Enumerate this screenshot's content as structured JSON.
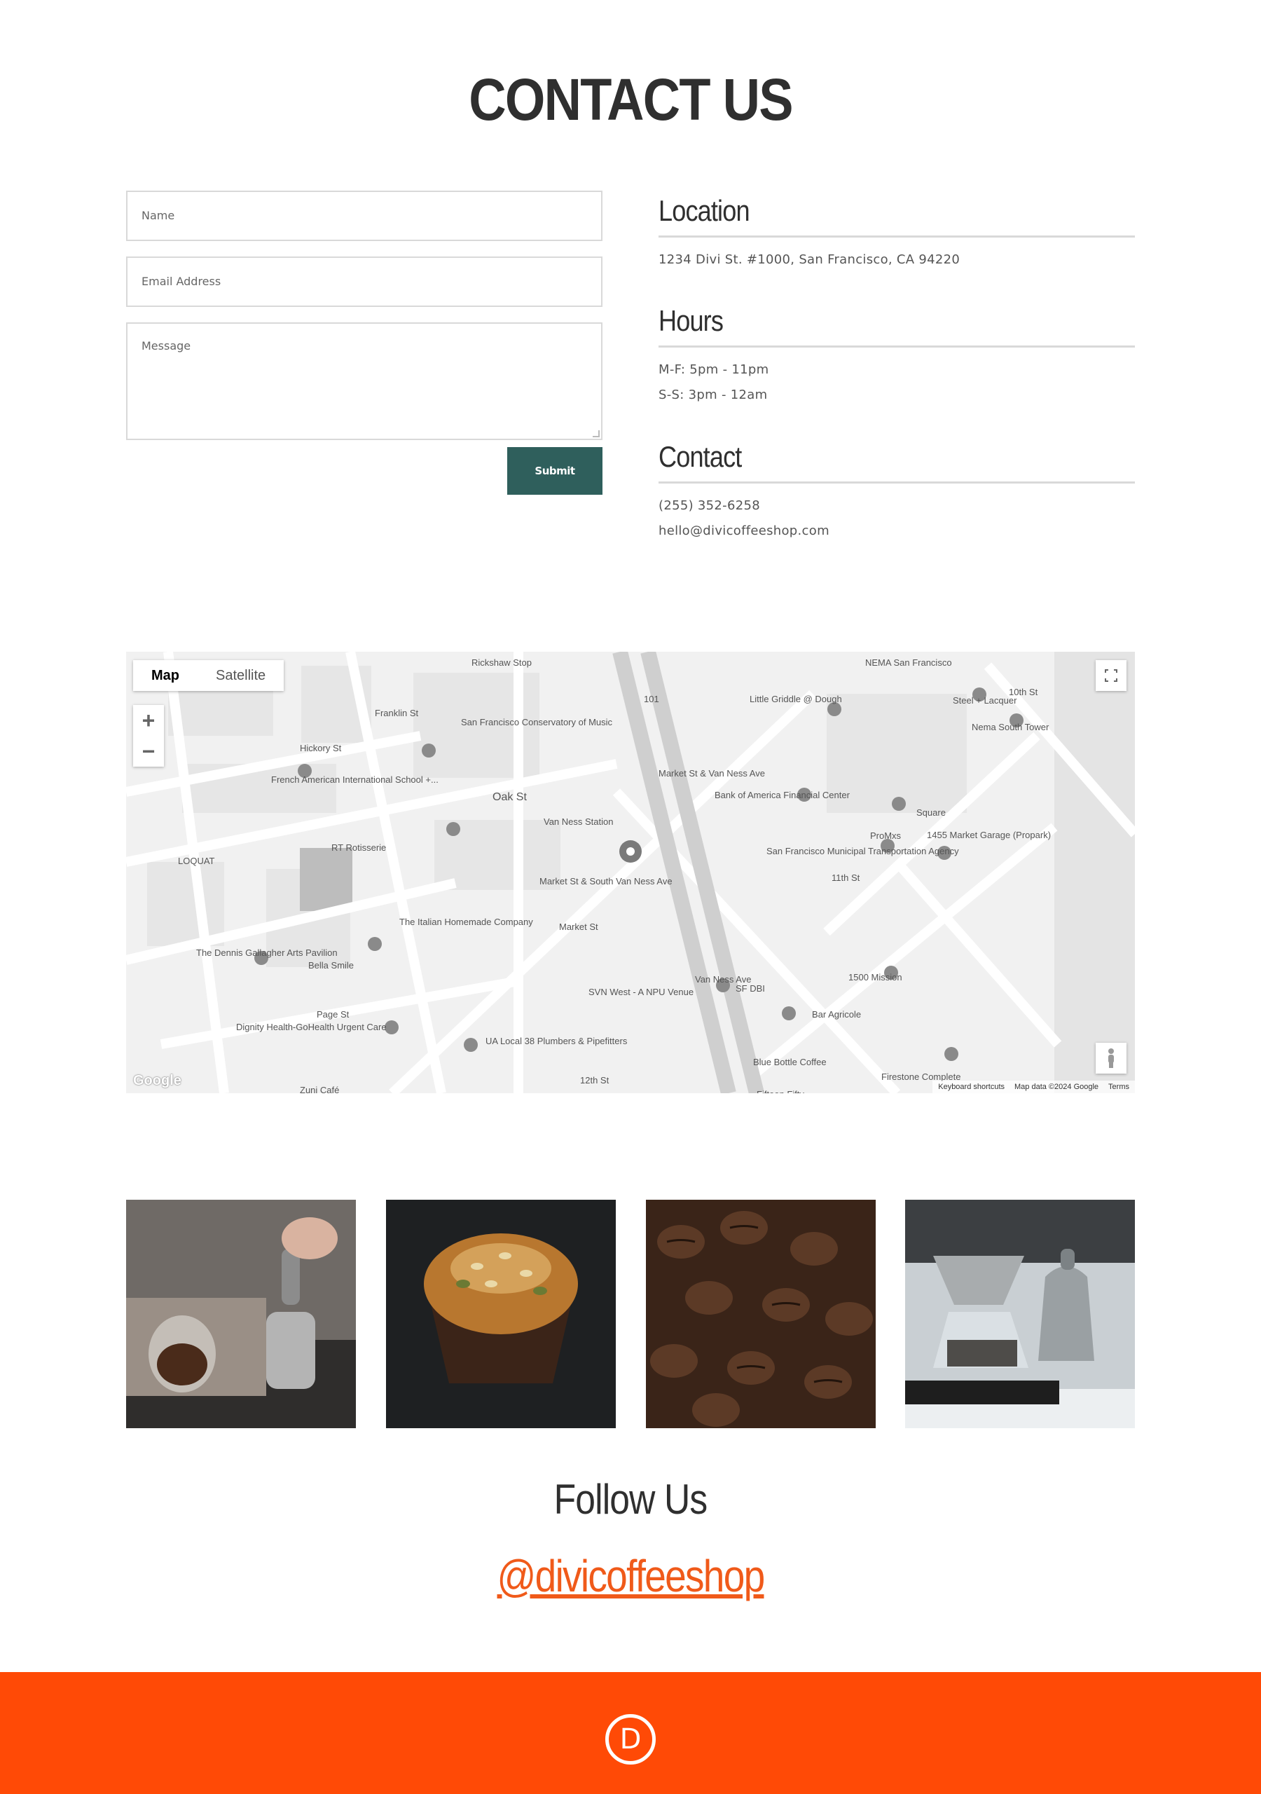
{
  "page": {
    "title": "CONTACT US"
  },
  "form": {
    "name_placeholder": "Name",
    "email_placeholder": "Email Address",
    "message_placeholder": "Message",
    "submit_label": "Submit"
  },
  "info": {
    "location": {
      "heading": "Location",
      "address": "1234 Divi St. #1000, San Francisco, CA 94220"
    },
    "hours": {
      "heading": "Hours",
      "weekday": "M-F: 5pm - 11pm",
      "weekend": "S-S: 3pm - 12am"
    },
    "contact": {
      "heading": "Contact",
      "phone": "(255) 352-6258",
      "email": "hello@divicoffeeshop.com"
    }
  },
  "map": {
    "type_map": "Map",
    "type_satellite": "Satellite",
    "zoom_in": "+",
    "zoom_out": "−",
    "google": "Google",
    "footer_shortcuts": "Keyboard shortcuts",
    "footer_data": "Map data ©2024 Google",
    "footer_terms": "Terms",
    "labels": [
      "Rickshaw Stop",
      "NEMA San Francisco",
      "10th St",
      "Little Griddle @ Dough",
      "Steel + Lacquer",
      "Nema South Tower",
      "Franklin St",
      "San Francisco Conservatory of Music",
      "Hickory St",
      "French American International School +...",
      "Oak St",
      "Market St & Van Ness Ave",
      "Bank of America Financial Center",
      "Square",
      "ProMxs",
      "1455 Market Garage (Propark)",
      "Van Ness Station",
      "RT Rotisserie",
      "LOQUAT",
      "San Francisco Municipal Transportation Agency",
      "11th St",
      "Market St & South Van Ness Ave",
      "Market St",
      "The Italian Homemade Company",
      "The Dennis Gallagher Arts Pavilion",
      "Bella Smile",
      "SVN West - A NPU Venue",
      "Van Ness Ave",
      "SF DBI",
      "1500 Mission",
      "Bar Agricole",
      "Page St",
      "Dignity Health-GoHealth Urgent Care",
      "UA Local 38 Plumbers & Pipefitters",
      "Blue Bottle Coffee",
      "Firestone Complete",
      "12th St",
      "Zuni Café",
      "Fifteen Fifty",
      "101"
    ]
  },
  "gallery": {
    "images": [
      "espresso-tamping-photo",
      "muffin-photo",
      "coffee-beans-photo",
      "pour-over-kettle-photo"
    ]
  },
  "follow": {
    "title": "Follow Us",
    "handle": "@divicoffeeshop"
  },
  "footer": {
    "logo_letter": "D"
  },
  "colors": {
    "accent": "#ff4a06",
    "button": "#2f5f5c",
    "handle": "#f05a1a"
  }
}
